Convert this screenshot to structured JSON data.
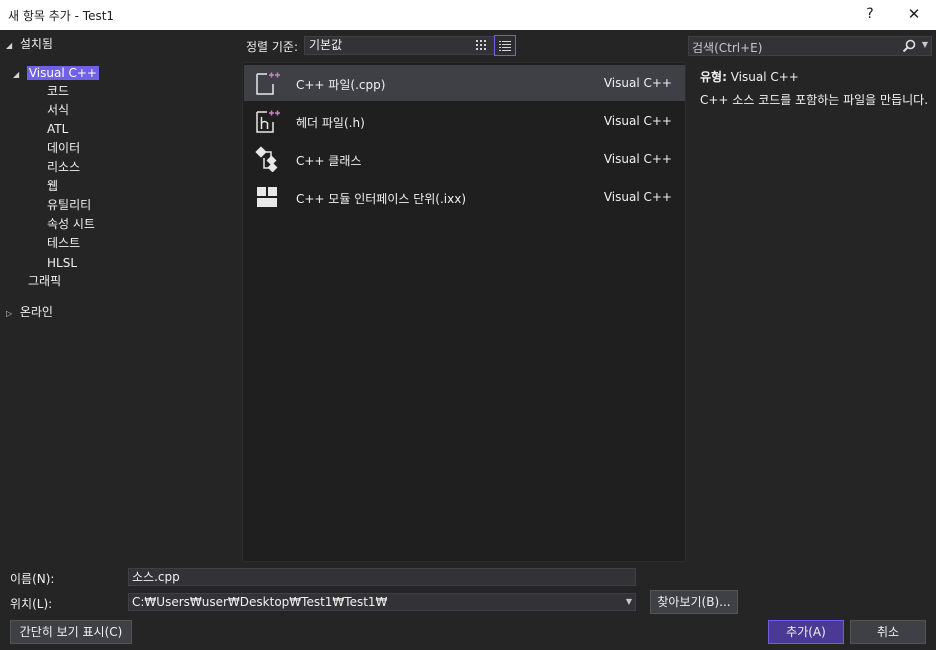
{
  "window": {
    "title": "새 항목 추가 - Test1",
    "help_label": "?",
    "close_label": "✕"
  },
  "sidebar": {
    "installed_label": "설치됨",
    "visual_cpp_label": "Visual C++",
    "children": [
      "코드",
      "서식",
      "ATL",
      "데이터",
      "리소스",
      "웹",
      "유틸리티",
      "속성 시트",
      "테스트",
      "HLSL"
    ],
    "graphics_label": "그래픽",
    "online_label": "온라인"
  },
  "toolbar": {
    "sort_label": "정렬 기준:",
    "sort_value": "기본값"
  },
  "search": {
    "placeholder": "검색(Ctrl+E)"
  },
  "templates": [
    {
      "name": "C++ 파일(.cpp)",
      "lang": "Visual C++",
      "icon": "cpp-file-icon",
      "selected": true
    },
    {
      "name": "헤더 파일(.h)",
      "lang": "Visual C++",
      "icon": "header-file-icon",
      "selected": false
    },
    {
      "name": "C++ 클래스",
      "lang": "Visual C++",
      "icon": "cpp-class-icon",
      "selected": false
    },
    {
      "name": "C++ 모듈 인터페이스 단위(.ixx)",
      "lang": "Visual C++",
      "icon": "module-interface-icon",
      "selected": false
    }
  ],
  "details": {
    "type_key": "유형:",
    "type_value": "Visual C++",
    "description": "C++ 소스 코드를 포함하는 파일을 만듭니다."
  },
  "form": {
    "name_label": "이름(N):",
    "name_value": "소스.cpp",
    "location_label": "위치(L):",
    "location_value": "C:₩Users₩user₩Desktop₩Test1₩Test1₩",
    "browse_label": "찾아보기(B)...",
    "compact_view_label": "간단히 보기 표시(C)",
    "add_label": "추가(A)",
    "cancel_label": "취소"
  },
  "colors": {
    "accent": "#7160e8",
    "background": "#252526",
    "list_background": "#1f1f1f",
    "selected_row": "#3f3f46",
    "icon_plus": "#c586c0"
  }
}
